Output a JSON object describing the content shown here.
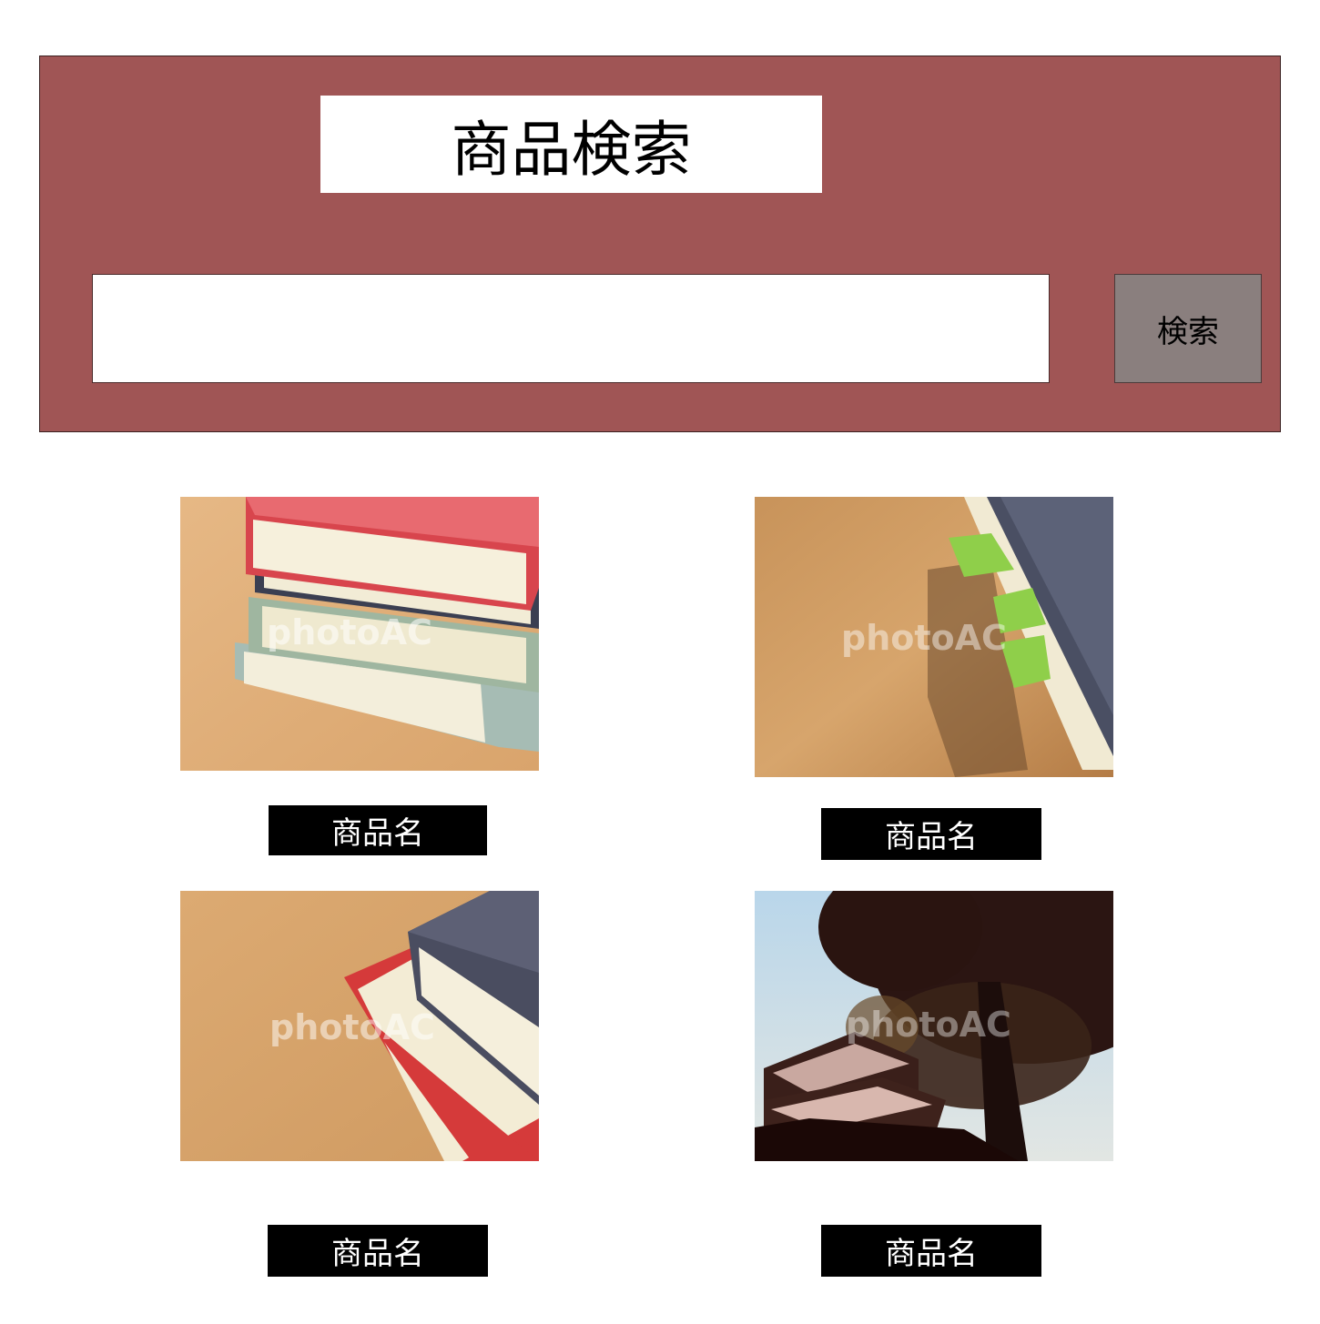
{
  "header": {
    "title": "商品検索",
    "search_placeholder": "",
    "search_value": "",
    "search_button_label": "検索",
    "background_color": "#a05555",
    "button_color": "#8a7f7e"
  },
  "products": [
    {
      "name": "商品名",
      "image": "stacked-books-on-cork-photo",
      "watermark": "photoAC"
    },
    {
      "name": "商品名",
      "image": "book-with-green-sticky-tabs-photo",
      "watermark": "photoAC"
    },
    {
      "name": "商品名",
      "image": "red-and-navy-books-on-cork-photo",
      "watermark": "photoAC"
    },
    {
      "name": "商品名",
      "image": "books-under-tree-photo",
      "watermark": "photoAC"
    }
  ]
}
